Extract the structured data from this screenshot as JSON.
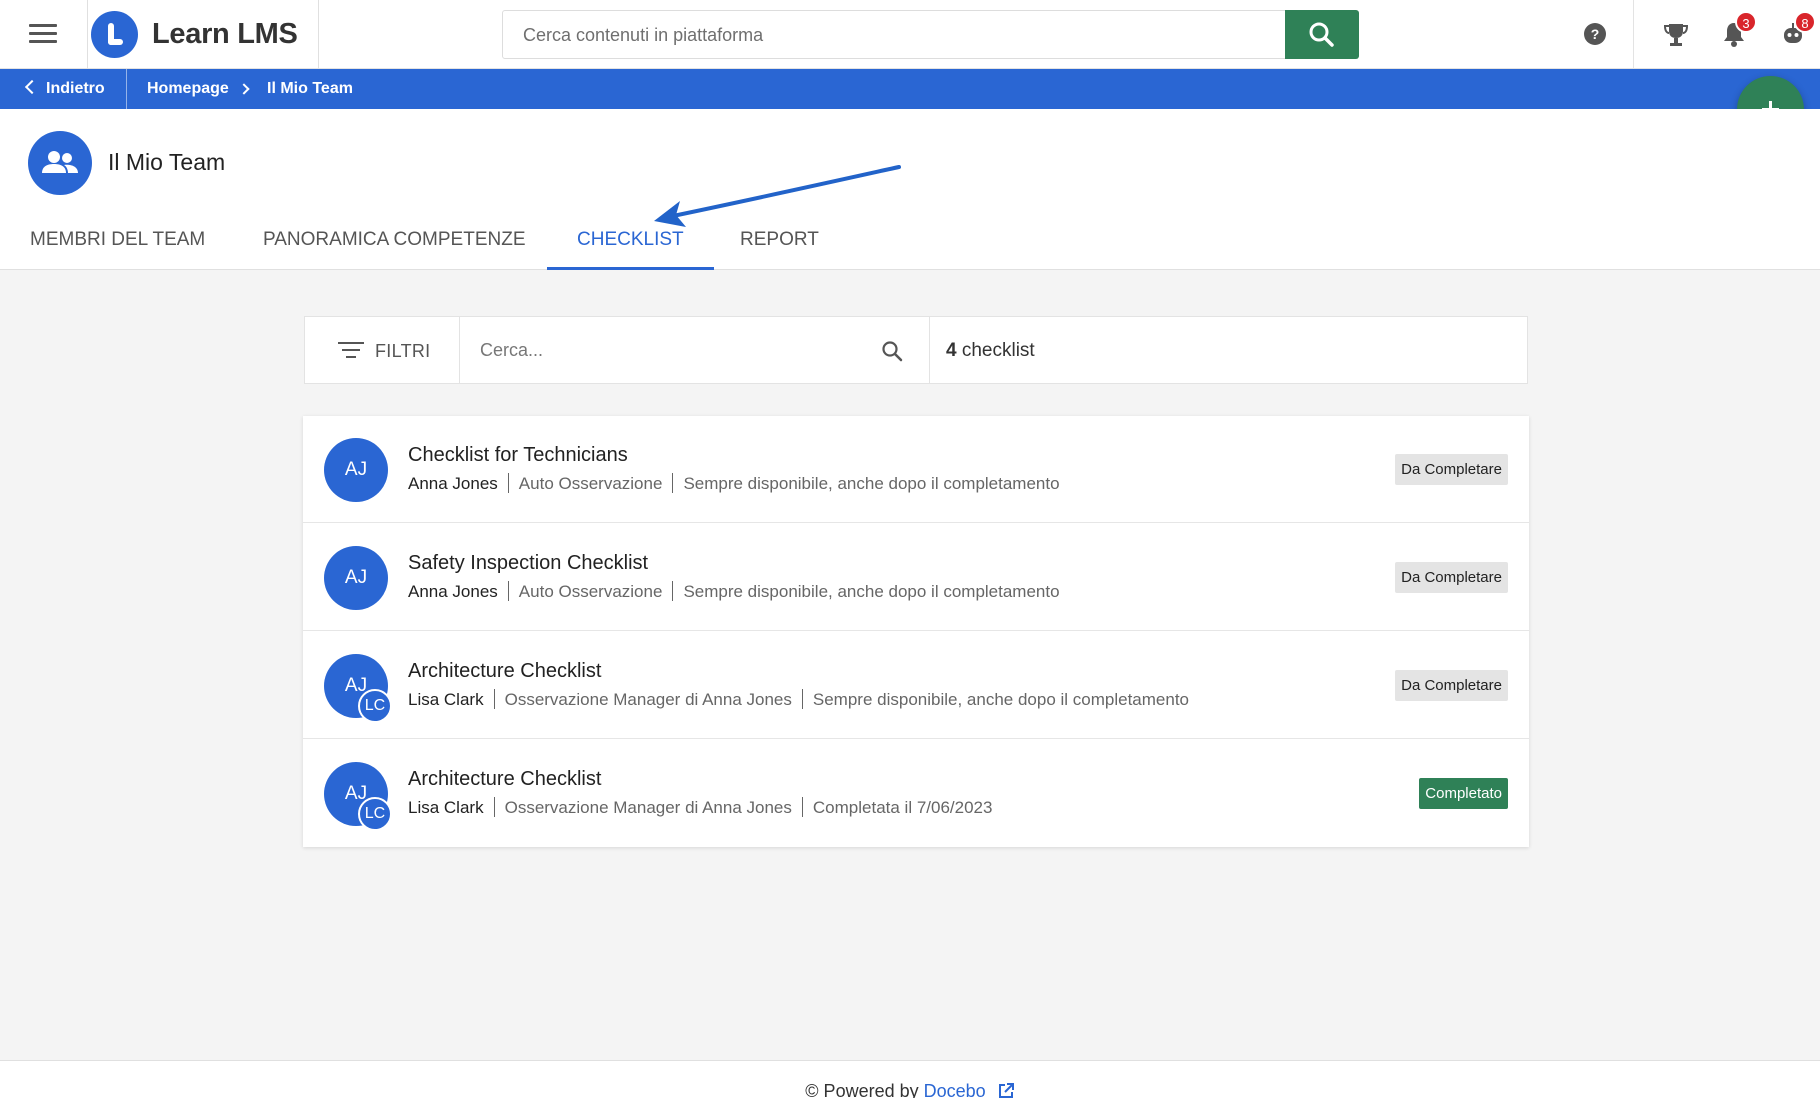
{
  "header": {
    "app_title": "Learn LMS",
    "search": {
      "placeholder": "Cerca contenuti in piattaforma"
    },
    "notifications_count": "3",
    "messages_count": "8"
  },
  "breadcrumb": {
    "back_label": "Indietro",
    "items": [
      "Homepage",
      "Il Mio Team"
    ]
  },
  "page": {
    "title": "Il Mio Team",
    "tabs": [
      {
        "label": "MEMBRI DEL TEAM"
      },
      {
        "label": "PANORAMICA COMPETENZE"
      },
      {
        "label": "CHECKLIST"
      },
      {
        "label": "REPORT"
      }
    ],
    "active_tab": "CHECKLIST"
  },
  "filter": {
    "label": "FILTRI",
    "search_placeholder": "Cerca...",
    "count_number": "4",
    "count_label": "checklist"
  },
  "checklists": [
    {
      "title": "Checklist for Technicians",
      "who": "Anna Jones",
      "type": "Auto Osservazione",
      "availability": "Sempre disponibile, anche dopo il completamento",
      "status": "Da Completare",
      "avatar": "AJ",
      "avatar2": ""
    },
    {
      "title": "Safety Inspection Checklist",
      "who": "Anna Jones",
      "type": "Auto Osservazione",
      "availability": "Sempre disponibile, anche dopo il completamento",
      "status": "Da Completare",
      "avatar": "AJ",
      "avatar2": ""
    },
    {
      "title": "Architecture Checklist",
      "who": "Lisa Clark",
      "type": "Osservazione Manager di Anna Jones",
      "availability": "Sempre disponibile, anche dopo il completamento",
      "status": "Da Completare",
      "avatar": "AJ",
      "avatar2": "LC"
    },
    {
      "title": "Architecture Checklist",
      "who": "Lisa Clark",
      "type": "Osservazione Manager di Anna Jones",
      "availability": "Completata il 7/06/2023",
      "status": "Completato",
      "avatar": "AJ",
      "avatar2": "LC"
    }
  ],
  "footer": {
    "prefix": "© Powered by",
    "brand": "Docebo"
  },
  "colors": {
    "primary": "#2a66d3",
    "success": "#2f8157",
    "badge": "#d9252b"
  }
}
